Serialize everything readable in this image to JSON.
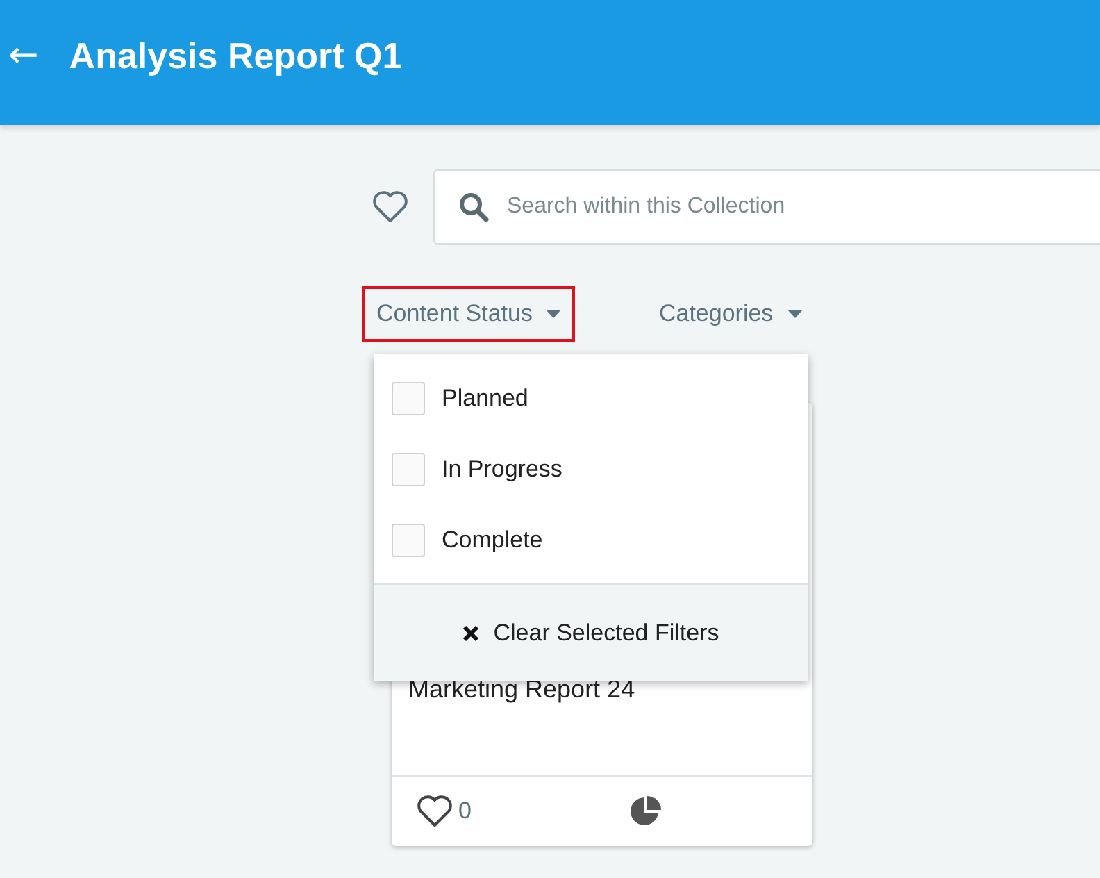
{
  "header": {
    "back_icon": "←",
    "title": "Analysis Report Q1"
  },
  "search": {
    "placeholder": "Search within this Collection"
  },
  "filters": [
    {
      "label": "Content Status",
      "selected": true
    },
    {
      "label": "Categories",
      "selected": false
    }
  ],
  "dropdown": {
    "options": [
      {
        "label": "Planned",
        "checked": false
      },
      {
        "label": "In Progress",
        "checked": false
      },
      {
        "label": "Complete",
        "checked": false
      }
    ],
    "clear_label": "Clear Selected Filters"
  },
  "card": {
    "title": "Marketing Report 24",
    "likes": "0"
  }
}
